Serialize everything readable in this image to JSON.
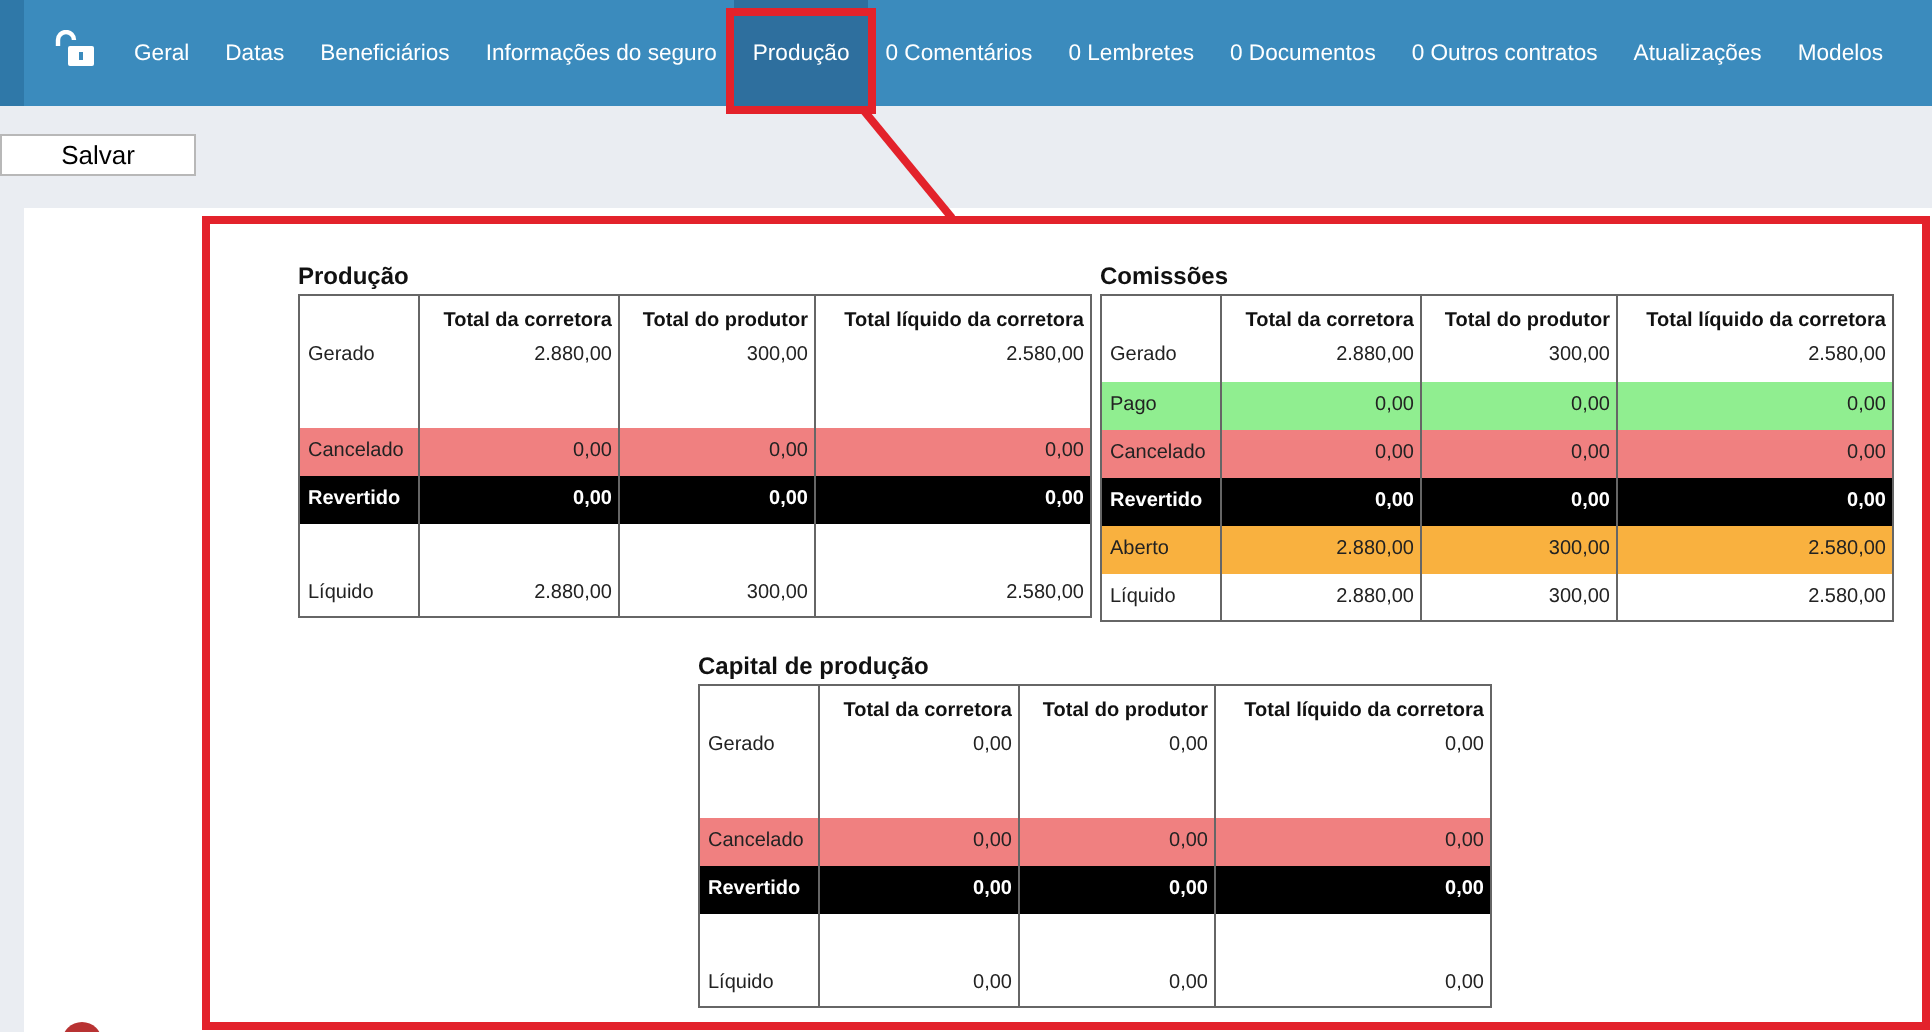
{
  "nav": {
    "tabs": [
      {
        "label": "Geral",
        "selected": false
      },
      {
        "label": "Datas",
        "selected": false
      },
      {
        "label": "Beneficiários",
        "selected": false
      },
      {
        "label": "Informações do seguro",
        "selected": false
      },
      {
        "label": "Produção",
        "selected": true
      },
      {
        "label": "0 Comentários",
        "selected": false
      },
      {
        "label": "0 Lembretes",
        "selected": false
      },
      {
        "label": "0 Documentos",
        "selected": false
      },
      {
        "label": "0 Outros contratos",
        "selected": false
      },
      {
        "label": "Atualizações",
        "selected": false
      },
      {
        "label": "Modelos",
        "selected": false
      }
    ]
  },
  "save_button": "Salvar",
  "tables": [
    {
      "title": "Produção",
      "columns": [
        "Total da corretora",
        "Total do produtor",
        "Total líquido da corretora"
      ],
      "rows": [
        {
          "label": "Gerado",
          "kind": "generated",
          "tall": true,
          "values": [
            "2.880,00",
            "300,00",
            "2.580,00"
          ]
        },
        {
          "label": "Cancelado",
          "kind": "cancelled",
          "tall": false,
          "values": [
            "0,00",
            "0,00",
            "0,00"
          ]
        },
        {
          "label": "Revertido",
          "kind": "reversed",
          "tall": false,
          "values": [
            "0,00",
            "0,00",
            "0,00"
          ]
        },
        {
          "label": "Líquido",
          "kind": "net",
          "tall": true,
          "values": [
            "2.880,00",
            "300,00",
            "2.580,00"
          ]
        }
      ]
    },
    {
      "title": "Comissões",
      "columns": [
        "Total da corretora",
        "Total do produtor",
        "Total líquido da corretora"
      ],
      "rows": [
        {
          "label": "Gerado",
          "kind": "generated",
          "tall": false,
          "values": [
            "2.880,00",
            "300,00",
            "2.580,00"
          ]
        },
        {
          "label": "Pago",
          "kind": "paid",
          "tall": false,
          "values": [
            "0,00",
            "0,00",
            "0,00"
          ]
        },
        {
          "label": "Cancelado",
          "kind": "cancelled",
          "tall": false,
          "values": [
            "0,00",
            "0,00",
            "0,00"
          ]
        },
        {
          "label": "Revertido",
          "kind": "reversed",
          "tall": false,
          "values": [
            "0,00",
            "0,00",
            "0,00"
          ]
        },
        {
          "label": "Aberto",
          "kind": "open",
          "tall": false,
          "values": [
            "2.880,00",
            "300,00",
            "2.580,00"
          ]
        },
        {
          "label": "Líquido",
          "kind": "net",
          "tall": false,
          "values": [
            "2.880,00",
            "300,00",
            "2.580,00"
          ]
        }
      ]
    },
    {
      "title": "Capital de produção",
      "columns": [
        "Total da corretora",
        "Total do produtor",
        "Total líquido da corretora"
      ],
      "rows": [
        {
          "label": "Gerado",
          "kind": "generated",
          "tall": true,
          "values": [
            "0,00",
            "0,00",
            "0,00"
          ]
        },
        {
          "label": "Cancelado",
          "kind": "cancelled",
          "tall": false,
          "values": [
            "0,00",
            "0,00",
            "0,00"
          ]
        },
        {
          "label": "Revertido",
          "kind": "reversed",
          "tall": false,
          "values": [
            "0,00",
            "0,00",
            "0,00"
          ]
        },
        {
          "label": "Líquido",
          "kind": "net",
          "tall": true,
          "values": [
            "0,00",
            "0,00",
            "0,00"
          ]
        }
      ]
    }
  ]
}
